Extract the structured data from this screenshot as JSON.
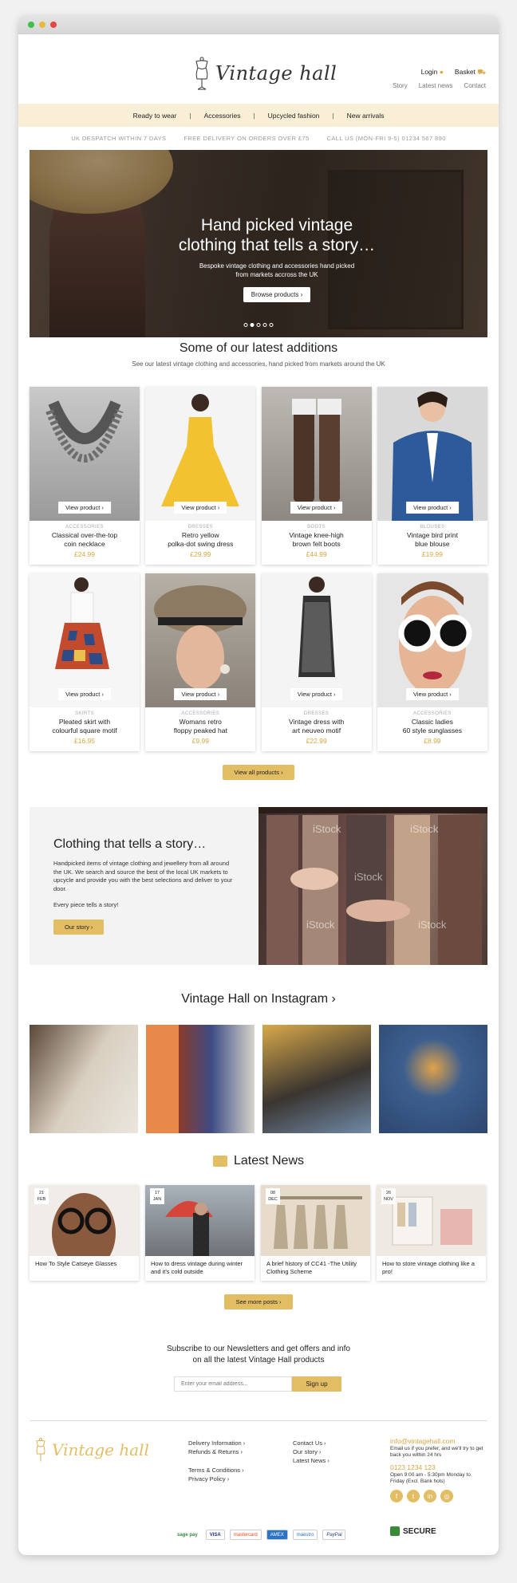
{
  "brand": {
    "name": "Vintage hall"
  },
  "header": {
    "login": "Login",
    "basket": "Basket",
    "story": "Story",
    "latest_news": "Latest news",
    "contact": "Contact"
  },
  "nav": {
    "items": [
      "Ready to wear",
      "Accessories",
      "Upcycled fashion",
      "New arrivals"
    ]
  },
  "strip": {
    "despatch": "UK DESPATCH WITHIN 7 DAYS",
    "delivery": "FREE DELIVERY ON ORDERS OVER £75",
    "call": "CALL US (MON-FRI 9-5) 01234 567 890"
  },
  "hero": {
    "title_line1": "Hand picked vintage",
    "title_line2": "clothing that tells a story…",
    "sub_line1": "Bespoke vintage clothing and accessories hand picked",
    "sub_line2": "from markets accross the UK",
    "button": "Browse products ›"
  },
  "latest": {
    "title": "Some of our latest additions",
    "subtitle": "See our latest vintage clothing and accessories, hand picked from markets around the UK",
    "view_all": "View all products ›",
    "view_product": "View product ›",
    "products": [
      {
        "category": "ACCESSORIES",
        "name1": "Classical over-the-top",
        "name2": "coin necklace",
        "price": "£24.99"
      },
      {
        "category": "DRESSES",
        "name1": "Retro yellow",
        "name2": "polka-dot swing dress",
        "price": "£29.99"
      },
      {
        "category": "BOOTS",
        "name1": "Vintage knee-high",
        "name2": "brown felt boots",
        "price": "£44.99"
      },
      {
        "category": "BLOUSES",
        "name1": "Vintage bird print",
        "name2": "blue blouse",
        "price": "£19.99"
      },
      {
        "category": "SKIRTS",
        "name1": "Pleated skirt with",
        "name2": "colourful square motif",
        "price": "£16.95"
      },
      {
        "category": "ACCESSORIES",
        "name1": "Womans retro",
        "name2": "floppy peaked hat",
        "price": "£9.99"
      },
      {
        "category": "DRESSES",
        "name1": "Vintage dress with",
        "name2": "art neuveo motif",
        "price": "£22.99"
      },
      {
        "category": "ACCESSORIES",
        "name1": "Classic ladies",
        "name2": "60 style sunglasses",
        "price": "£8.99"
      }
    ]
  },
  "story": {
    "title": "Clothing that tells a story…",
    "body": "Handpicked items of vintage clothing and jewellery from all around the UK. We search and source the best of the local UK markets to upcycle and provide you with the best selections and deliver to your door.",
    "tagline": "Every piece tells a story!",
    "button": "Our story ›",
    "watermark": "iStock"
  },
  "instagram": {
    "title": "Vintage Hall on Instagram ›"
  },
  "news": {
    "title": "Latest News",
    "more": "See more posts ›",
    "posts": [
      {
        "day": "21",
        "month": "FEB",
        "title": "How To Style Catseye Glasses"
      },
      {
        "day": "17",
        "month": "JAN",
        "title": "How to dress vintage during winter and it's cold outside"
      },
      {
        "day": "08",
        "month": "DEC",
        "title": "A brief history of CC41 -The Utility Clothing Scheme"
      },
      {
        "day": "26",
        "month": "NOV",
        "title": "How to store vintage clothing like a pro!"
      }
    ]
  },
  "newsletter": {
    "line1": "Subscribe to our Newsletters and get offers and info",
    "line2": "on all the latest Vintage Hall products",
    "placeholder": "Enter your email address...",
    "button": "Sign up"
  },
  "footer": {
    "col1": [
      "Delivery Information ›",
      "Refunds & Returns ›"
    ],
    "col1b": [
      "Terms & Conditions ›",
      "Privacy Policy ›"
    ],
    "col2": [
      "Contact Us ›",
      "Our story ›",
      "Latest News ›"
    ],
    "email": "info@vintagehall.com",
    "email_note": "Email us if you prefer, and we'll try to get back you within 24 hrs",
    "phone": "0123 1234 123",
    "hours": "Open 9:00 am - 5:30pm Monday to Friday (Excl. Bank hols)",
    "payments": [
      "sage pay",
      "VISA",
      "mastercard",
      "AMEX",
      "maestro",
      "PayPal"
    ],
    "secure": "SECURE"
  }
}
